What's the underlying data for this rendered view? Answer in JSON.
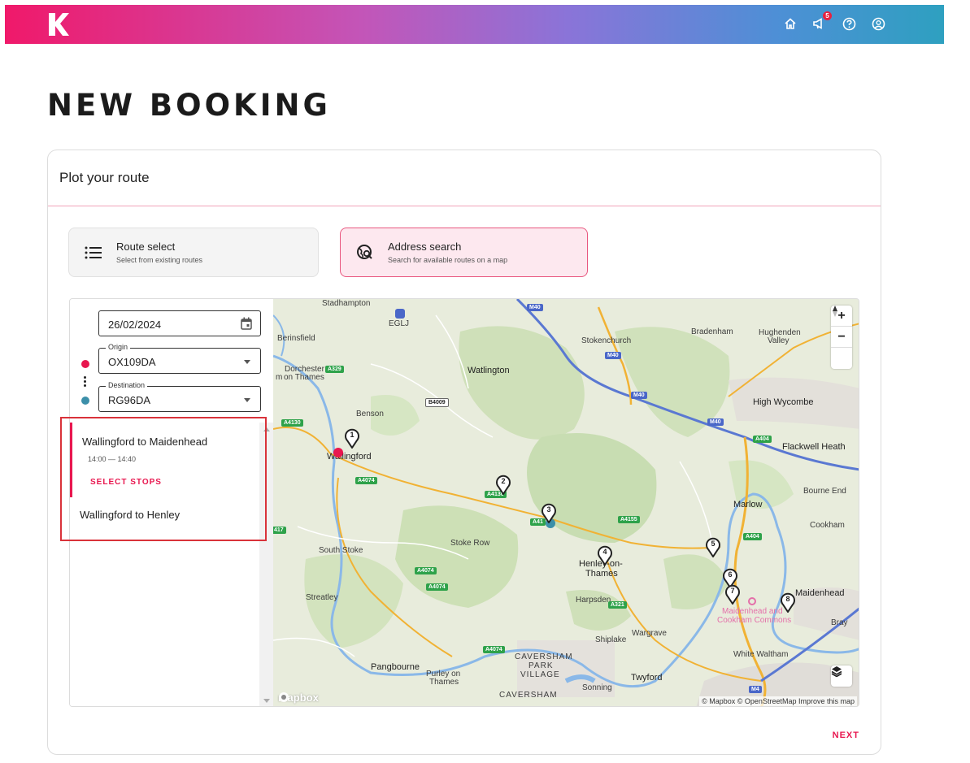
{
  "app": {
    "logo_letter": "K",
    "notification_count": "5"
  },
  "top_icons": [
    "home-icon",
    "megaphone-icon",
    "help-icon",
    "account-icon"
  ],
  "page": {
    "title": "NEW BOOKING"
  },
  "card": {
    "title": "Plot your route",
    "next_label": "NEXT"
  },
  "modes": {
    "route_select": {
      "title": "Route select",
      "subtitle": "Select from existing routes"
    },
    "address_search": {
      "title": "Address search",
      "subtitle": "Search for available routes on a map"
    }
  },
  "form": {
    "date": "26/02/2024",
    "origin": {
      "label": "Origin",
      "value": "OX109DA"
    },
    "destination": {
      "label": "Destination",
      "value": "RG96DA"
    }
  },
  "results": [
    {
      "name": "Wallingford to Maidenhead",
      "time": "14:00 — 14:40",
      "action": "SELECT STOPS"
    },
    {
      "name": "Wallingford to Henley"
    }
  ],
  "map": {
    "places": {
      "stadhampton": "Stadhampton",
      "eglj": "EGLJ",
      "berinsfield": "Berinsfield",
      "dorchester": "Dorchester",
      "on_thames": "on Thames",
      "m": "m",
      "watlington": "Watlington",
      "stokenchurch": "Stokenchurch",
      "bradenham": "Bradenham",
      "hughenden": "Hughenden",
      "valley": "Valley",
      "high_wycombe": "High Wycombe",
      "benson": "Benson",
      "wallingford": "Wallingford",
      "flackwell_heath": "Flackwell Heath",
      "bourne_end": "Bourne End",
      "marlow": "Marlow",
      "cookham": "Cookham",
      "south_stoke": "South Stoke",
      "stoke_row": "Stoke Row",
      "henley": "Henley-on-",
      "thames": "Thames",
      "maidenhead": "Maidenhead",
      "maidenhead_commons_1": "Maidenhead and",
      "maidenhead_commons_2": "Cookham Commons",
      "bray": "Bray",
      "streatley": "Streatley",
      "harpsden": "Harpsden",
      "wargrave": "Wargrave",
      "shiplake": "Shiplake",
      "white_waltham": "White Waltham",
      "caversham_park_1": "CAVERSHAM",
      "caversham_park_2": "PARK",
      "caversham_park_3": "VILLAGE",
      "pangbourne": "Pangbourne",
      "purley_1": "Purley on",
      "purley_2": "Thames",
      "twyford": "Twyford",
      "sonning": "Sonning",
      "caversham": "CAVERSHAM"
    },
    "roads": {
      "m40_a": "M40",
      "m40_b": "M40",
      "m40_c": "M40",
      "m40_d": "M40",
      "a329": "A329",
      "b4009": "B4009",
      "a4130": "A4130",
      "a4074_a": "A4074",
      "a4130_b": "A4130",
      "a4155": "A4155",
      "a404_a": "A404",
      "a404_b": "A404",
      "a417": "417",
      "a4074_b": "A4074",
      "a4074_c": "A4074",
      "a321": "A321",
      "a4074_d": "A4074",
      "a41": "A41",
      "m4": "M4"
    },
    "stops": [
      "1",
      "2",
      "3",
      "4",
      "5",
      "6",
      "7",
      "8"
    ],
    "controls": {
      "zoom_in": "+",
      "zoom_out": "−"
    },
    "attribution": "© Mapbox © OpenStreetMap  Improve this map",
    "logo": "mapbox"
  }
}
